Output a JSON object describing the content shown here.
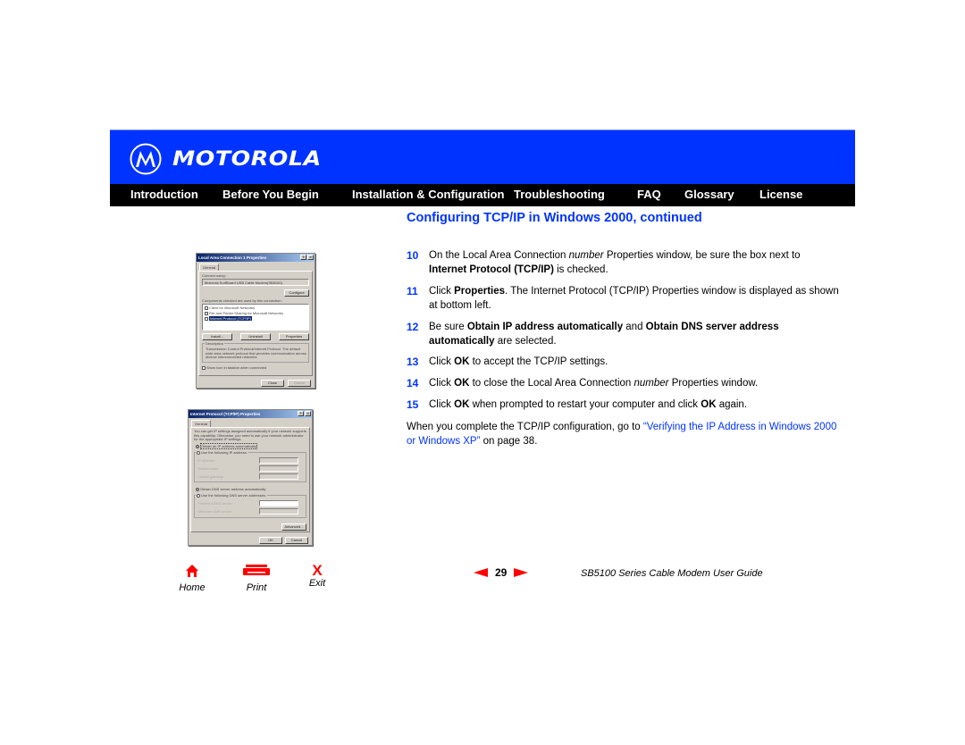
{
  "header": {
    "brand": "MOTOROLA",
    "logo_icon": "motorola-batwing-icon",
    "colors": {
      "banner": "#0033ff",
      "navbar": "#000000",
      "accent": "#0033ff",
      "footer_icons": "#ff0000"
    }
  },
  "nav": {
    "items": [
      {
        "label": "Introduction"
      },
      {
        "label": "Before You Begin"
      },
      {
        "label": "Installation & Configuration"
      },
      {
        "label": "Troubleshooting"
      },
      {
        "label": "FAQ"
      },
      {
        "label": "Glossary"
      },
      {
        "label": "License"
      }
    ]
  },
  "page": {
    "title": "Configuring TCP/IP in Windows 2000, continued",
    "steps": [
      {
        "num": "10",
        "parts": [
          {
            "t": "On the Local Area Connection "
          },
          {
            "t": "number",
            "style": "i"
          },
          {
            "t": " Properties window, be sure the box next to "
          },
          {
            "t": "Internet Protocol (TCP/IP)",
            "style": "b"
          },
          {
            "t": " is checked."
          }
        ]
      },
      {
        "num": "11",
        "parts": [
          {
            "t": "Click "
          },
          {
            "t": "Properties",
            "style": "b"
          },
          {
            "t": ". The Internet Protocol (TCP/IP) Properties window is displayed as shown at bottom left."
          }
        ]
      },
      {
        "num": "12",
        "parts": [
          {
            "t": "Be sure "
          },
          {
            "t": "Obtain IP address automatically",
            "style": "b"
          },
          {
            "t": " and "
          },
          {
            "t": "Obtain DNS server address automatically",
            "style": "b"
          },
          {
            "t": " are selected."
          }
        ]
      },
      {
        "num": "13",
        "parts": [
          {
            "t": "Click "
          },
          {
            "t": "OK",
            "style": "b"
          },
          {
            "t": " to accept the TCP/IP settings."
          }
        ]
      },
      {
        "num": "14",
        "parts": [
          {
            "t": "Click "
          },
          {
            "t": "OK",
            "style": "b"
          },
          {
            "t": " to close the Local Area Connection "
          },
          {
            "t": "number",
            "style": "i"
          },
          {
            "t": " Properties window."
          }
        ]
      },
      {
        "num": "15",
        "parts": [
          {
            "t": "Click "
          },
          {
            "t": "OK",
            "style": "b"
          },
          {
            "t": " when prompted to restart your computer and click "
          },
          {
            "t": "OK",
            "style": "b"
          },
          {
            "t": " again."
          }
        ]
      }
    ],
    "closing": {
      "prefix": "When you complete the TCP/IP configuration, go to ",
      "link": "“Verifying the IP Address in Windows 2000 or Windows XP”",
      "suffix": " on page 38."
    }
  },
  "dialog1": {
    "title": "Local Area Connection 1 Properties",
    "tab": "General",
    "connect_using_label": "Connect using:",
    "adapter": "Motorola SurfBoard USB Cable Modem(SB5100)",
    "configure_btn": "Configure",
    "components_label": "Components checked are used by this connection:",
    "components": [
      {
        "label": "Client for Microsoft Networks",
        "checked": true,
        "selected": false
      },
      {
        "label": "File and Printer Sharing for Microsoft Networks",
        "checked": true,
        "selected": false
      },
      {
        "label": "Internet Protocol (TCP/IP)",
        "checked": true,
        "selected": true
      }
    ],
    "install_btn": "Install...",
    "uninstall_btn": "Uninstall",
    "properties_btn": "Properties",
    "description_label": "Description",
    "description": "Transmission Control Protocol/Internet Protocol. The default wide area network protocol that provides communication across diverse interconnected networks.",
    "show_icon_label": "Show icon in taskbar when connected",
    "close_btn": "Close",
    "cancel_btn": "Cancel"
  },
  "dialog2": {
    "title": "Internet Protocol (TCP/IP) Properties",
    "tab": "General",
    "intro": "You can get IP settings assigned automatically if your network supports this capability. Otherwise, you need to ask your network administrator for the appropriate IP settings.",
    "obtain_ip": "Obtain an IP address automatically",
    "use_ip": "Use the following IP address:",
    "ip_label": "IP address:",
    "subnet_label": "Subnet mask:",
    "gateway_label": "Default gateway:",
    "obtain_dns": "Obtain DNS server address automatically",
    "use_dns": "Use the following DNS server addresses:",
    "pref_dns_label": "Preferred DNS server:",
    "alt_dns_label": "Alternate DNS server:",
    "advanced_btn": "Advanced...",
    "ok_btn": "OK",
    "cancel_btn": "Cancel"
  },
  "footer": {
    "home": {
      "label": "Home",
      "icon": "home-icon"
    },
    "print": {
      "label": "Print",
      "icon": "printer-icon"
    },
    "exit": {
      "label": "Exit",
      "icon": "exit-x-icon",
      "glyph": "X"
    },
    "page_number": "29",
    "guide_title": "SB5100 Series Cable Modem User Guide"
  }
}
